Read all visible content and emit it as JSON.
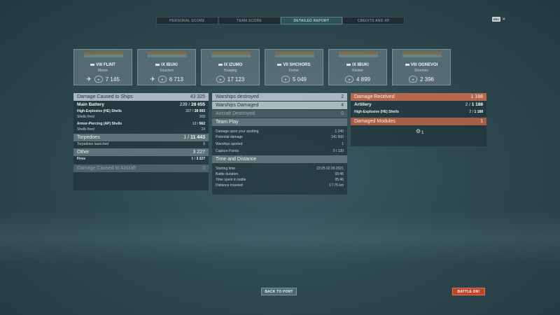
{
  "tabs": [
    "PERSONAL SCORE",
    "TEAM SCORE",
    "DETAILED REPORT",
    "CREDITS AND XP"
  ],
  "active_tab": 2,
  "esc": {
    "key": "ESC",
    "icon": "close-icon",
    "glyph": "✕"
  },
  "ships": [
    {
      "tier": "VIII",
      "name": "FLINT",
      "player": "Meore",
      "score": "7 145",
      "plane": true
    },
    {
      "tier": "IX",
      "name": "IBUKI",
      "player": "Souchen",
      "score": "6 713",
      "plane": true
    },
    {
      "tier": "IX",
      "name": "IZUMO",
      "player": "Huaqing",
      "score": "17 123",
      "plane": false
    },
    {
      "tier": "VII",
      "name": "SHCHORS",
      "player": "Fisher",
      "score": "5 049",
      "plane": false
    },
    {
      "tier": "IX",
      "name": "IBUKI",
      "player": "Kiester",
      "score": "4 899",
      "plane": false
    },
    {
      "tier": "VIII",
      "name": "OGNEVOI",
      "player": "Shornley",
      "score": "2 396",
      "plane": false
    }
  ],
  "left": {
    "header": {
      "label": "Damage Caused to Ships",
      "value": "43 325"
    },
    "main_battery": {
      "label": "Main Battery",
      "hits": "239",
      "total": "28 655"
    },
    "he": {
      "label": "High-Explosive (HE) Shells",
      "hits": "227",
      "dmg": "28 093",
      "fired_label": "Shells fired",
      "fired": "368"
    },
    "ap": {
      "label": "Armor-Piercing (AP) Shells",
      "hits": "12",
      "dmg": "562",
      "fired_label": "Shells fired",
      "fired": "24"
    },
    "torpedoes": {
      "label": "Torpedoes",
      "hits": "1",
      "dmg": "11 443",
      "launched_label": "Torpedoes launched",
      "launched": "8"
    },
    "other": {
      "label": "Other",
      "value": "3 227",
      "fires_label": "Fires",
      "fires": "5",
      "fires_dmg": "3 227"
    },
    "aircraft": {
      "label": "Damage Caused to Aircraft",
      "value": "0"
    }
  },
  "middle": {
    "destroyed": {
      "label": "Warships destroyed",
      "value": "2"
    },
    "damaged": {
      "label": "Warships Damaged",
      "value": "4"
    },
    "aircraft": {
      "label": "Aircraft Destroyed",
      "value": "0"
    },
    "team_play": {
      "label": "Team Play",
      "rows": [
        {
          "label": "Damage upon your spotting",
          "value": "1 240"
        },
        {
          "label": "Potential damage",
          "value": "141 500"
        },
        {
          "label": "Warships spotted",
          "value": "1"
        },
        {
          "label": "Capture Points",
          "value": "0 / 120"
        }
      ]
    },
    "time": {
      "label": "Time and Distance",
      "rows": [
        {
          "label": "Starting time",
          "value": "22:25  02.09.2021"
        },
        {
          "label": "Battle duration",
          "value": "05:46"
        },
        {
          "label": "Time spent in battle",
          "value": "05:46"
        },
        {
          "label": "Distance traveled",
          "value": "17.75 km"
        }
      ]
    }
  },
  "right": {
    "received": {
      "label": "Damage Received",
      "value": "1 188"
    },
    "artillery": {
      "label": "Artillery",
      "hits": "2",
      "dmg": "1 188"
    },
    "he": {
      "label": "High-Explosive (HE) Shells",
      "hits": "2",
      "dmg": "1 188"
    },
    "modules": {
      "label": "Damaged Modules",
      "value": "1",
      "icon": "turret-icon",
      "count": "1"
    }
  },
  "buttons": {
    "back": "BACK TO PORT",
    "battle": "BATTLE ON!"
  }
}
